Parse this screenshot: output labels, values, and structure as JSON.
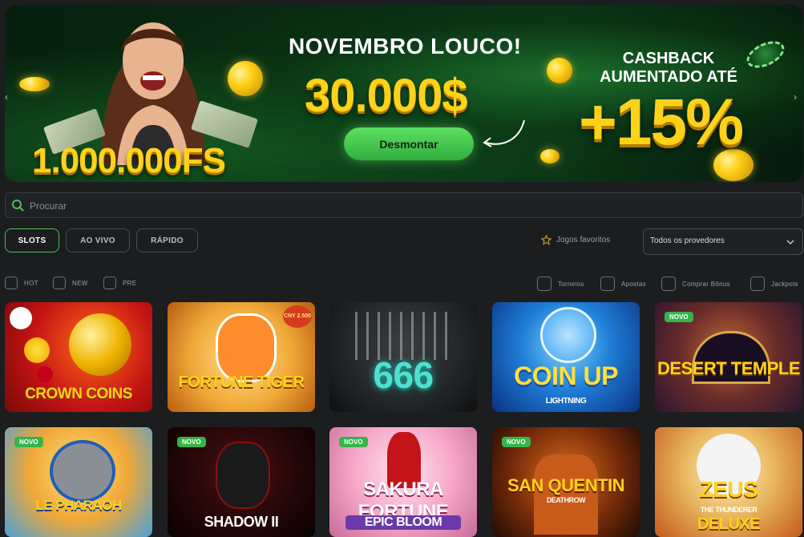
{
  "banner": {
    "headline": "NOVEMBRO LOUCO!",
    "amount": "30.000$",
    "freespins": "1.000.000FS",
    "cashback_line1": "CASHBACK",
    "cashback_line2": "AUMENTADO ATÉ",
    "percent": "+15%",
    "cta_label": "Desmontar",
    "accent": "#ffd21a",
    "cta_color": "#47c259"
  },
  "search": {
    "placeholder": "Procurar"
  },
  "tabs": [
    {
      "label": "SLOTS",
      "active": true
    },
    {
      "label": "AO VIVO",
      "active": false
    },
    {
      "label": "RÁPIDO",
      "active": false
    }
  ],
  "favorites_label": "Jogos favoritos",
  "provider_select": {
    "selected": "Todos os provedores"
  },
  "filters_left": [
    "HOT",
    "NEW",
    "PRE"
  ],
  "filters_right": [
    "Torneios",
    "Apostas",
    "Comprar Bônus",
    "Jackpots"
  ],
  "badge_new": "NOVO",
  "games": [
    {
      "title": "CROWN COINS",
      "new": false
    },
    {
      "title": "FORTUNE TIGER",
      "new": false,
      "tag": "CNY 2.500"
    },
    {
      "title": "666",
      "new": false
    },
    {
      "title": "COIN UP",
      "subtitle": "LIGHTNING",
      "new": false
    },
    {
      "title": "DESERT TEMPLE",
      "new": true
    },
    {
      "title": "LE PHARAOH",
      "new": true
    },
    {
      "title": "SHADOW II",
      "new": true
    },
    {
      "title": "SAKURA FORTUNE",
      "subtitle": "EPIC BLOOM",
      "new": true
    },
    {
      "title": "SAN QUENTIN",
      "subtitle": "DEATHROW",
      "new": true
    },
    {
      "title": "ZEUS",
      "subtitle": "THE THUNDERER",
      "extra": "DELUXE",
      "new": false
    }
  ]
}
